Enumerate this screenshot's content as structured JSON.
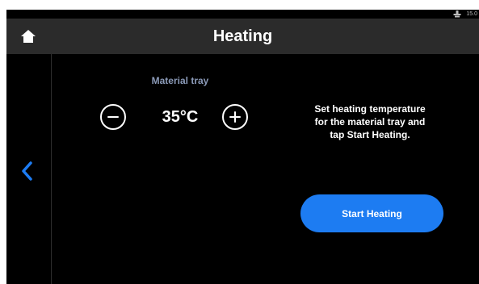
{
  "status_bar": {
    "icon": "stage-icon",
    "value": "15.0"
  },
  "header": {
    "home_icon": "home-icon",
    "title": "Heating"
  },
  "nav": {
    "back_icon": "chevron-left-icon"
  },
  "tray": {
    "label": "Material tray",
    "temperature": "35°C",
    "decrease_icon": "minus-icon",
    "increase_icon": "plus-icon"
  },
  "instructions": {
    "line1": "Set heating temperature",
    "line2": "for the material tray and",
    "line3": "tap Start Heating."
  },
  "actions": {
    "start_label": "Start Heating"
  },
  "colors": {
    "accent": "#1d7cf2",
    "title_bar": "#2b2b2b",
    "background": "#000000",
    "label": "#8b9ab8"
  }
}
